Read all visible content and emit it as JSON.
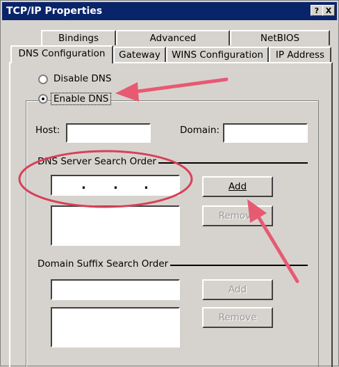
{
  "window": {
    "title": "TCP/IP Properties",
    "help_button": "?",
    "close_button": "X"
  },
  "tabs_back": [
    "Bindings",
    "Advanced",
    "NetBIOS"
  ],
  "tabs_front": [
    "DNS Configuration",
    "Gateway",
    "WINS Configuration",
    "IP Address"
  ],
  "dns": {
    "disable_label": "Disable DNS",
    "enable_label": "Enable DNS",
    "enable_selected": true,
    "host_label": "Host:",
    "host_value": "",
    "domain_label": "Domain:",
    "domain_value": "",
    "server_section": "DNS Server Search Order",
    "server_ip": ". . .",
    "add_button": "Add",
    "remove_button": "Remove",
    "suffix_section": "Domain Suffix Search Order",
    "suffix_add_button": "Add",
    "suffix_remove_button": "Remove"
  },
  "annotation_colors": {
    "arrow": "#e85a72",
    "circle": "#d8405a"
  }
}
